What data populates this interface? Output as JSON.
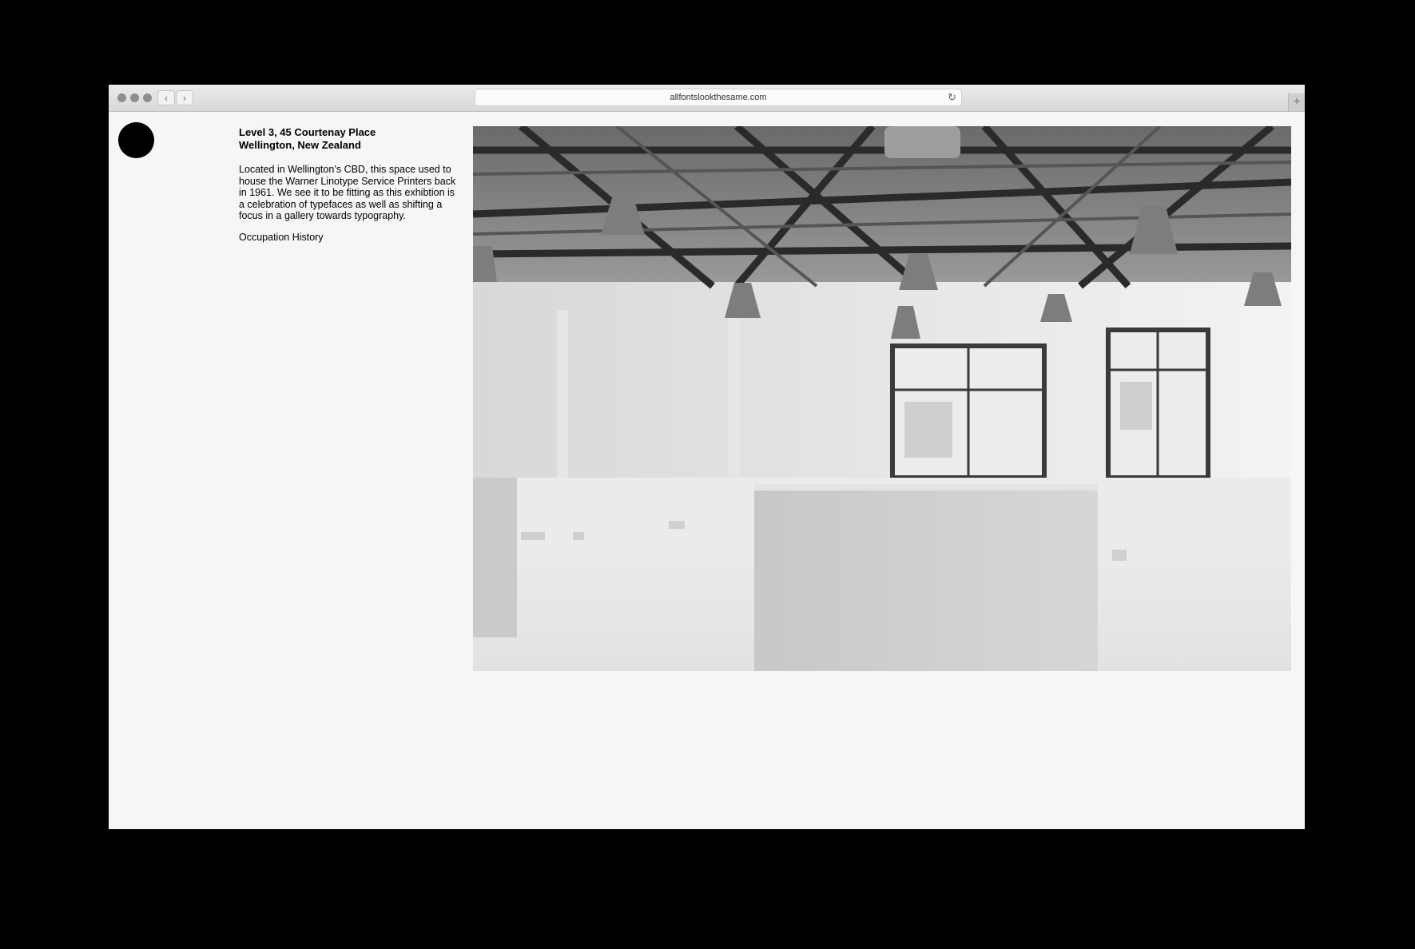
{
  "browser": {
    "url": "allfontslookthesame.com",
    "back_glyph": "‹",
    "forward_glyph": "›",
    "reload_glyph": "↻",
    "newtab_glyph": "+"
  },
  "venue": {
    "address_line1": "Level 3, 45 Courtenay Place",
    "address_line2": "Wellington, New Zealand",
    "description": "Located in Wellington’s CBD, this space used to house the Warner Linotype Service Printers back in 1961. We see it to be fitting as this exhibtion is a celebration of typefaces as well as shifting a focus in a gallery towards typography.",
    "history_link": "Occupation History"
  },
  "icons": {
    "logo": "logo-dot-icon",
    "back": "chevron-left-icon",
    "forward": "chevron-right-icon",
    "reload": "reload-icon",
    "newtab": "plus-icon"
  },
  "colors": {
    "page_bg": "#000000",
    "content_bg": "#f6f6f6",
    "text": "#000000"
  }
}
